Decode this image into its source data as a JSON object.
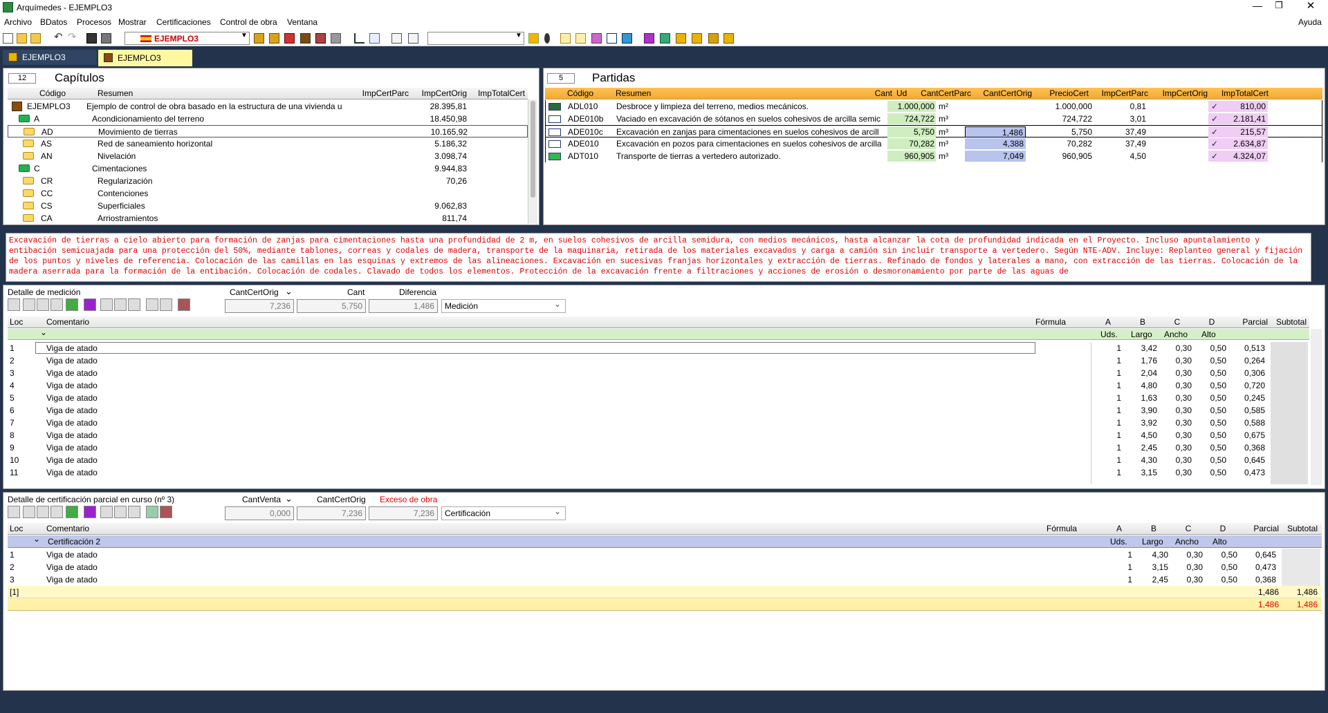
{
  "window": {
    "title": "Arquímedes - EJEMPLO3"
  },
  "menu": [
    "Archivo",
    "BDatos",
    "Procesos",
    "Mostrar",
    "Certificaciones",
    "Control de obra",
    "Ventana"
  ],
  "help": "Ayuda",
  "toolbar": {
    "project_combo": "EJEMPLO3"
  },
  "tabs": [
    {
      "label": "EJEMPLO3"
    },
    {
      "label": "EJEMPLO3"
    }
  ],
  "capitulos": {
    "count": "12",
    "title": "Capítulos",
    "columns": [
      "Código",
      "Resumen",
      "ImpCertParc",
      "ImpCertOrig",
      "ImpTotalCert"
    ],
    "rows": [
      {
        "code": "EJEMPLO3",
        "summary": "Ejemplo de control de obra basado en la estructura de una vivienda u",
        "orig": "28.395,81"
      },
      {
        "code": "A",
        "summary": "Acondicionamiento del terreno",
        "orig": "18.450,98"
      },
      {
        "code": "AD",
        "summary": "Movimiento de tierras",
        "orig": "10.165,92"
      },
      {
        "code": "AS",
        "summary": "Red de saneamiento horizontal",
        "orig": "5.186,32"
      },
      {
        "code": "AN",
        "summary": "Nivelación",
        "orig": "3.098,74"
      },
      {
        "code": "C",
        "summary": "Cimentaciones",
        "orig": "9.944,83"
      },
      {
        "code": "CR",
        "summary": "Regularización",
        "orig": "70,26"
      },
      {
        "code": "CC",
        "summary": "Contenciones",
        "orig": ""
      },
      {
        "code": "CS",
        "summary": "Superficiales",
        "orig": "9.062,83"
      },
      {
        "code": "CA",
        "summary": "Arriostramientos",
        "orig": "811,74"
      }
    ]
  },
  "partidas": {
    "count": "5",
    "title": "Partidas",
    "columns": [
      "Código",
      "Resumen",
      "Cant",
      "Ud",
      "CantCertParc",
      "CantCertOrig",
      "PrecioCert",
      "ImpCertParc",
      "ImpCertOrig",
      "ImpTotalCert"
    ],
    "check": "✓",
    "rows": [
      {
        "code": "ADL010",
        "summary": "Desbroce y limpieza del terreno, medios mecánicos.",
        "cant": "1.000,000",
        "ud": "m²",
        "parc": "",
        "orig": "1.000,000",
        "precio": "0,81",
        "imp": "810,00"
      },
      {
        "code": "ADE010b",
        "summary": "Vaciado en excavación de sótanos en suelos cohesivos de arcilla semic",
        "cant": "724,722",
        "ud": "m³",
        "parc": "",
        "orig": "724,722",
        "precio": "3,01",
        "imp": "2.181,41"
      },
      {
        "code": "ADE010c",
        "summary": "Excavación en zanjas para cimentaciones en suelos cohesivos de arcill",
        "cant": "5,750",
        "ud": "m³",
        "parc": "1,486",
        "orig": "5,750",
        "precio": "37,49",
        "imp": "215,57"
      },
      {
        "code": "ADE010",
        "summary": "Excavación en pozos para cimentaciones en suelos cohesivos de arcilla",
        "cant": "70,282",
        "ud": "m³",
        "parc": "4,388",
        "orig": "70,282",
        "precio": "37,49",
        "imp": "2.634,87"
      },
      {
        "code": "ADT010",
        "summary": "Transporte de tierras a vertedero autorizado.",
        "cant": "960,905",
        "ud": "m³",
        "parc": "7,049",
        "orig": "960,905",
        "precio": "4,50",
        "imp": "4.324,07"
      }
    ]
  },
  "description": "Excavación de tierras a cielo abierto para formación de zanjas para cimentaciones hasta una profundidad de 2 m, en suelos cohesivos de arcilla semidura, con medios mecánicos, hasta alcanzar la cota de profundidad indicada en el Proyecto. Incluso apuntalamiento y entibación semicuajada para una protección del 50%, mediante tablones, correas y codales de madera, transporte de la maquinaria, retirada de los materiales excavados y carga a camión sin incluir transporte a vertedero. Según NTE-ADV. Incluye: Replanteo general y fijación de los puntos y niveles de referencia. Colocación de las camillas en las esquinas y extremos de las alineaciones. Excavación en sucesivas franjas horizontales y extracción de tierras. Refinado de fondos y laterales a mano, con extracción de las tierras. Colocación de la madera aserrada para la formación de la entibación. Colocación de codales. Clavado de todos los elementos. Protección de la excavación frente a filtraciones y acciones de erosión o desmoronamiento por parte de las aguas de",
  "medicion": {
    "title": "Detalle de medición",
    "labels": {
      "a": "CantCertOrig",
      "b": "Cant",
      "c": "Diferencia"
    },
    "values": {
      "a": "7,236",
      "b": "5,750",
      "c": "1,486"
    },
    "mode": "Medición",
    "columns": [
      "Loc",
      "Comentario",
      "Fórmula",
      "A",
      "B",
      "C",
      "D",
      "Parcial",
      "Subtotal"
    ],
    "subcols": [
      "Uds.",
      "Largo",
      "Ancho",
      "Alto"
    ],
    "rows": [
      {
        "loc": "1",
        "com": "Viga de atado",
        "a": "1",
        "b": "3,42",
        "c": "0,30",
        "d": "0,50",
        "p": "0,513"
      },
      {
        "loc": "2",
        "com": "Viga de atado",
        "a": "1",
        "b": "1,76",
        "c": "0,30",
        "d": "0,50",
        "p": "0,264"
      },
      {
        "loc": "3",
        "com": "Viga de atado",
        "a": "1",
        "b": "2,04",
        "c": "0,30",
        "d": "0,50",
        "p": "0,306"
      },
      {
        "loc": "4",
        "com": "Viga de atado",
        "a": "1",
        "b": "4,80",
        "c": "0,30",
        "d": "0,50",
        "p": "0,720"
      },
      {
        "loc": "5",
        "com": "Viga de atado",
        "a": "1",
        "b": "1,63",
        "c": "0,30",
        "d": "0,50",
        "p": "0,245"
      },
      {
        "loc": "6",
        "com": "Viga de atado",
        "a": "1",
        "b": "3,90",
        "c": "0,30",
        "d": "0,50",
        "p": "0,585"
      },
      {
        "loc": "7",
        "com": "Viga de atado",
        "a": "1",
        "b": "3,92",
        "c": "0,30",
        "d": "0,50",
        "p": "0,588"
      },
      {
        "loc": "8",
        "com": "Viga de atado",
        "a": "1",
        "b": "4,50",
        "c": "0,30",
        "d": "0,50",
        "p": "0,675"
      },
      {
        "loc": "9",
        "com": "Viga de atado",
        "a": "1",
        "b": "2,45",
        "c": "0,30",
        "d": "0,50",
        "p": "0,368"
      },
      {
        "loc": "10",
        "com": "Viga de atado",
        "a": "1",
        "b": "4,30",
        "c": "0,30",
        "d": "0,50",
        "p": "0,645"
      },
      {
        "loc": "11",
        "com": "Viga de atado",
        "a": "1",
        "b": "3,15",
        "c": "0,30",
        "d": "0,50",
        "p": "0,473"
      }
    ]
  },
  "certificacion": {
    "title": "Detalle de certificación parcial en curso (nº 3)",
    "labels": {
      "a": "CantVenta",
      "b": "CantCertOrig",
      "c": "Exceso de obra"
    },
    "values": {
      "a": "0,000",
      "b": "7,236",
      "c": "7,236"
    },
    "mode": "Certificación",
    "group": "Certificación 2",
    "columns": [
      "Loc",
      "Comentario",
      "Fórmula",
      "A",
      "B",
      "C",
      "D",
      "Parcial",
      "Subtotal"
    ],
    "subcols": [
      "Uds.",
      "Largo",
      "Ancho",
      "Alto"
    ],
    "rows": [
      {
        "loc": "1",
        "com": "Viga de atado",
        "a": "1",
        "b": "4,30",
        "c": "0,30",
        "d": "0,50",
        "p": "0,645"
      },
      {
        "loc": "2",
        "com": "Viga de atado",
        "a": "1",
        "b": "3,15",
        "c": "0,30",
        "d": "0,50",
        "p": "0,473"
      },
      {
        "loc": "3",
        "com": "Viga de atado",
        "a": "1",
        "b": "2,45",
        "c": "0,30",
        "d": "0,50",
        "p": "0,368"
      }
    ],
    "total_loc": "[1]",
    "total_parcial": "1,486",
    "total_subtotal": "1,486",
    "grand_parcial": "1,486",
    "grand_subtotal": "1,486"
  }
}
